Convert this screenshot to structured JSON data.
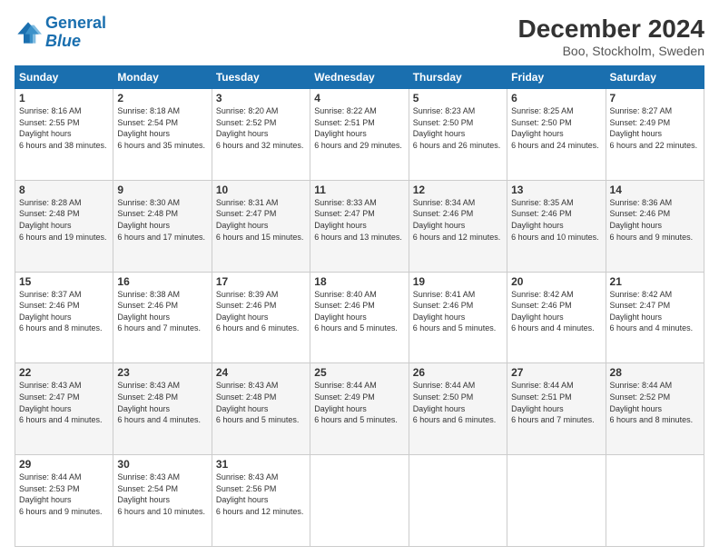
{
  "header": {
    "logo_line1": "General",
    "logo_line2": "Blue",
    "title": "December 2024",
    "subtitle": "Boo, Stockholm, Sweden"
  },
  "weekdays": [
    "Sunday",
    "Monday",
    "Tuesday",
    "Wednesday",
    "Thursday",
    "Friday",
    "Saturday"
  ],
  "weeks": [
    [
      {
        "day": "1",
        "sunrise": "8:16 AM",
        "sunset": "2:55 PM",
        "daylight": "6 hours and 38 minutes."
      },
      {
        "day": "2",
        "sunrise": "8:18 AM",
        "sunset": "2:54 PM",
        "daylight": "6 hours and 35 minutes."
      },
      {
        "day": "3",
        "sunrise": "8:20 AM",
        "sunset": "2:52 PM",
        "daylight": "6 hours and 32 minutes."
      },
      {
        "day": "4",
        "sunrise": "8:22 AM",
        "sunset": "2:51 PM",
        "daylight": "6 hours and 29 minutes."
      },
      {
        "day": "5",
        "sunrise": "8:23 AM",
        "sunset": "2:50 PM",
        "daylight": "6 hours and 26 minutes."
      },
      {
        "day": "6",
        "sunrise": "8:25 AM",
        "sunset": "2:50 PM",
        "daylight": "6 hours and 24 minutes."
      },
      {
        "day": "7",
        "sunrise": "8:27 AM",
        "sunset": "2:49 PM",
        "daylight": "6 hours and 22 minutes."
      }
    ],
    [
      {
        "day": "8",
        "sunrise": "8:28 AM",
        "sunset": "2:48 PM",
        "daylight": "6 hours and 19 minutes."
      },
      {
        "day": "9",
        "sunrise": "8:30 AM",
        "sunset": "2:48 PM",
        "daylight": "6 hours and 17 minutes."
      },
      {
        "day": "10",
        "sunrise": "8:31 AM",
        "sunset": "2:47 PM",
        "daylight": "6 hours and 15 minutes."
      },
      {
        "day": "11",
        "sunrise": "8:33 AM",
        "sunset": "2:47 PM",
        "daylight": "6 hours and 13 minutes."
      },
      {
        "day": "12",
        "sunrise": "8:34 AM",
        "sunset": "2:46 PM",
        "daylight": "6 hours and 12 minutes."
      },
      {
        "day": "13",
        "sunrise": "8:35 AM",
        "sunset": "2:46 PM",
        "daylight": "6 hours and 10 minutes."
      },
      {
        "day": "14",
        "sunrise": "8:36 AM",
        "sunset": "2:46 PM",
        "daylight": "6 hours and 9 minutes."
      }
    ],
    [
      {
        "day": "15",
        "sunrise": "8:37 AM",
        "sunset": "2:46 PM",
        "daylight": "6 hours and 8 minutes."
      },
      {
        "day": "16",
        "sunrise": "8:38 AM",
        "sunset": "2:46 PM",
        "daylight": "6 hours and 7 minutes."
      },
      {
        "day": "17",
        "sunrise": "8:39 AM",
        "sunset": "2:46 PM",
        "daylight": "6 hours and 6 minutes."
      },
      {
        "day": "18",
        "sunrise": "8:40 AM",
        "sunset": "2:46 PM",
        "daylight": "6 hours and 5 minutes."
      },
      {
        "day": "19",
        "sunrise": "8:41 AM",
        "sunset": "2:46 PM",
        "daylight": "6 hours and 5 minutes."
      },
      {
        "day": "20",
        "sunrise": "8:42 AM",
        "sunset": "2:46 PM",
        "daylight": "6 hours and 4 minutes."
      },
      {
        "day": "21",
        "sunrise": "8:42 AM",
        "sunset": "2:47 PM",
        "daylight": "6 hours and 4 minutes."
      }
    ],
    [
      {
        "day": "22",
        "sunrise": "8:43 AM",
        "sunset": "2:47 PM",
        "daylight": "6 hours and 4 minutes."
      },
      {
        "day": "23",
        "sunrise": "8:43 AM",
        "sunset": "2:48 PM",
        "daylight": "6 hours and 4 minutes."
      },
      {
        "day": "24",
        "sunrise": "8:43 AM",
        "sunset": "2:48 PM",
        "daylight": "6 hours and 5 minutes."
      },
      {
        "day": "25",
        "sunrise": "8:44 AM",
        "sunset": "2:49 PM",
        "daylight": "6 hours and 5 minutes."
      },
      {
        "day": "26",
        "sunrise": "8:44 AM",
        "sunset": "2:50 PM",
        "daylight": "6 hours and 6 minutes."
      },
      {
        "day": "27",
        "sunrise": "8:44 AM",
        "sunset": "2:51 PM",
        "daylight": "6 hours and 7 minutes."
      },
      {
        "day": "28",
        "sunrise": "8:44 AM",
        "sunset": "2:52 PM",
        "daylight": "6 hours and 8 minutes."
      }
    ],
    [
      {
        "day": "29",
        "sunrise": "8:44 AM",
        "sunset": "2:53 PM",
        "daylight": "6 hours and 9 minutes."
      },
      {
        "day": "30",
        "sunrise": "8:43 AM",
        "sunset": "2:54 PM",
        "daylight": "6 hours and 10 minutes."
      },
      {
        "day": "31",
        "sunrise": "8:43 AM",
        "sunset": "2:56 PM",
        "daylight": "6 hours and 12 minutes."
      },
      null,
      null,
      null,
      null
    ]
  ]
}
